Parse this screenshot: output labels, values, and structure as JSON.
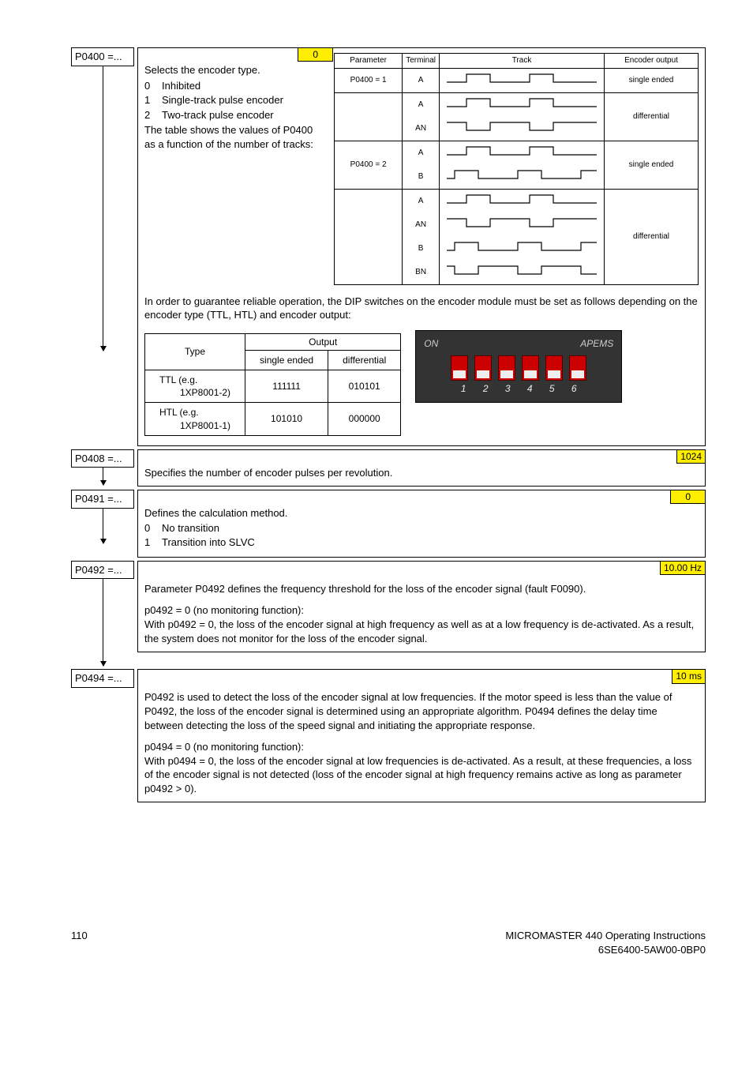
{
  "p0400": {
    "label": "P0400 =...",
    "top_highlight": "0",
    "left": {
      "intro": "Selects the encoder type.",
      "opts": [
        {
          "n": "0",
          "t": "Inhibited"
        },
        {
          "n": "1",
          "t": "Single-track pulse encoder"
        },
        {
          "n": "2",
          "t": "Two-track pulse encoder"
        }
      ],
      "below": "The table shows the values of P0400 as a function of the number of tracks:"
    },
    "wavehead": {
      "param": "Parameter",
      "term": "Terminal",
      "track": "Track",
      "out": "Encoder output"
    },
    "waverows": [
      {
        "param": "P0400 = 1",
        "out": "single ended",
        "sigs": [
          "A"
        ],
        "height": 1
      },
      {
        "param": "",
        "out": "differential",
        "sigs": [
          "A",
          "AN"
        ],
        "height": 2
      },
      {
        "param": "P0400 = 2",
        "out": "single ended",
        "sigs": [
          "A",
          "B"
        ],
        "height": 2
      },
      {
        "param": "",
        "out": "differential",
        "sigs": [
          "A",
          "AN",
          "B",
          "BN"
        ],
        "height": 4
      }
    ],
    "note": "In order to guarantee reliable operation, the DIP switches on the encoder module must be set as follows depending on the encoder type (TTL, HTL) and encoder output:",
    "enc_head": {
      "type": "Type",
      "output": "Output",
      "se": "single ended",
      "diff": "differential"
    },
    "enc_rows": [
      {
        "type_a": "TTL  (e.g.",
        "type_b": "1XP8001-2)",
        "se": "111111",
        "diff": "010101"
      },
      {
        "type_a": "HTL  (e.g.",
        "type_b": "1XP8001-1)",
        "se": "101010",
        "diff": "000000"
      }
    ],
    "dip": {
      "on": "ON",
      "apems": "APEMS",
      "nums": [
        "1",
        "2",
        "3",
        "4",
        "5",
        "6"
      ]
    }
  },
  "p0408": {
    "label": "P0408 =...",
    "highlight": "1024",
    "text": "Specifies the number of encoder pulses per revolution."
  },
  "p0491": {
    "label": "P0491 =...",
    "highlight": "0",
    "text": "Defines the calculation method.",
    "opts": [
      {
        "n": "0",
        "t": "No transition"
      },
      {
        "n": "1",
        "t": "Transition into SLVC"
      }
    ]
  },
  "p0492": {
    "label": "P0492 =...",
    "highlight": "10.00 Hz",
    "para1": "Parameter P0492 defines the frequency threshold for the loss of the encoder signal (fault F0090).",
    "para2a": "p0492 = 0 (no monitoring function):",
    "para2b": "With p0492 = 0, the loss of the encoder signal at high frequency as well as at a low frequency is de-activated. As a result, the system does not monitor for the loss of the encoder signal."
  },
  "p0494": {
    "label": "P0494 =...",
    "highlight": "10 ms",
    "para1": "P0492 is used to detect the loss of the encoder signal at low frequencies. If the motor speed is less than the value of P0492, the loss of the encoder signal is determined using an appropriate algorithm. P0494 defines the delay time between detecting the loss of the speed signal and initiating the appropriate response.",
    "para2a": "p0494 = 0 (no monitoring function):",
    "para2b": "With p0494 = 0, the loss of the encoder signal at low frequencies is de-activated. As a result, at these frequencies, a loss of the encoder signal is not detected (loss of the encoder signal at high frequency remains active as long as parameter p0492 > 0)."
  },
  "footer": {
    "page": "110",
    "r1": "MICROMASTER 440     Operating Instructions",
    "r2": "6SE6400-5AW00-0BP0"
  }
}
